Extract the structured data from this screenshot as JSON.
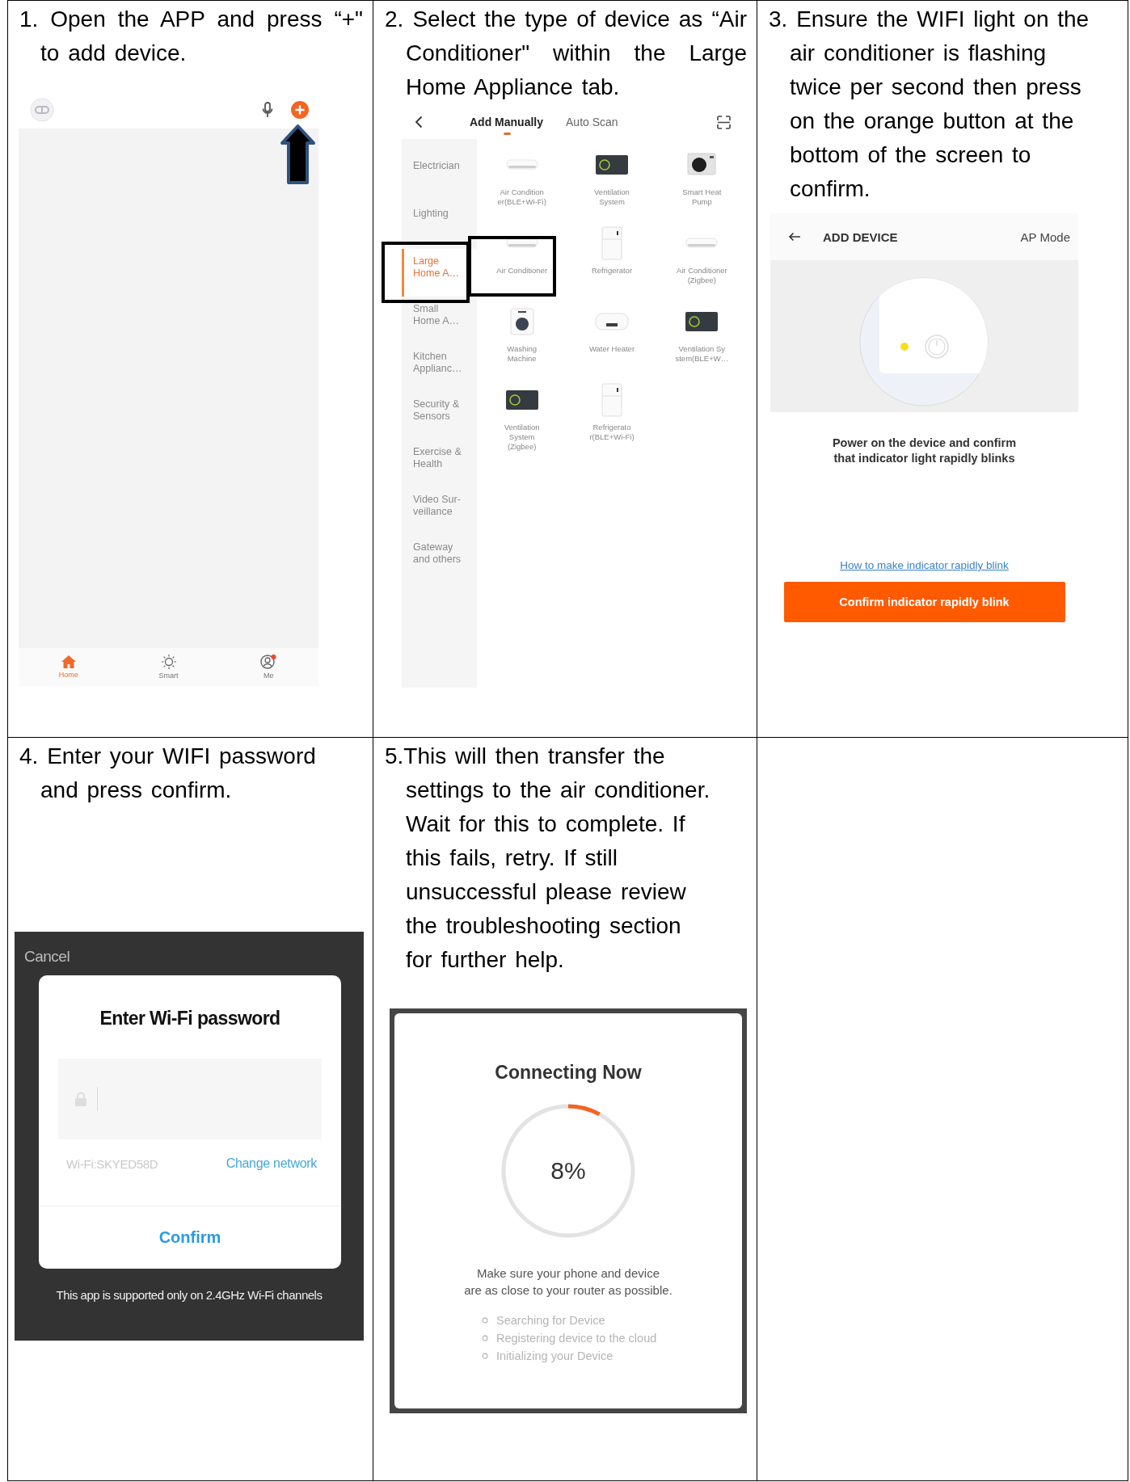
{
  "steps": [
    {
      "text": "1. Open the APP and press “+\" to add device.",
      "screen": {
        "kind": "home",
        "nav": [
          {
            "label": "Home",
            "selected": true
          },
          {
            "label": "Smart",
            "selected": false
          },
          {
            "label": "Me",
            "selected": false
          }
        ]
      }
    },
    {
      "text": "2. Select the type of device as “Air Conditioner\" within the Large Home Appliance tab.",
      "screen": {
        "kind": "catalog",
        "tabs": [
          {
            "label": "Add Manually",
            "selected": true
          },
          {
            "label": "Auto Scan",
            "selected": false
          }
        ],
        "categories": [
          {
            "label": "Electrician",
            "selected": false,
            "highlighted": false
          },
          {
            "label": "Lighting",
            "selected": false,
            "highlighted": false
          },
          {
            "label": "Large\nHome A…",
            "selected": true,
            "highlighted": true
          },
          {
            "label": "Small\nHome A…",
            "selected": false,
            "highlighted": false
          },
          {
            "label": "Kitchen\nApplianc…",
            "selected": false,
            "highlighted": false
          },
          {
            "label": "Security &\nSensors",
            "selected": false,
            "highlighted": false
          },
          {
            "label": "Exercise &\nHealth",
            "selected": false,
            "highlighted": false
          },
          {
            "label": "Video Sur-\nveillance",
            "selected": false,
            "highlighted": false
          },
          {
            "label": "Gateway\nand others",
            "selected": false,
            "highlighted": false
          }
        ],
        "devices": [
          {
            "label": "Air Condition\ner(BLE+Wi-Fi)",
            "kind": "ac",
            "highlighted": false
          },
          {
            "label": "Ventilation\nSystem",
            "kind": "vent",
            "highlighted": false
          },
          {
            "label": "Smart Heat\nPump",
            "kind": "heatpump",
            "highlighted": false
          },
          {
            "label": "Air Conditioner",
            "kind": "ac",
            "highlighted": true
          },
          {
            "label": "Refrigerator",
            "kind": "fridge",
            "highlighted": false
          },
          {
            "label": "Air Conditioner\n(Zigbee)",
            "kind": "ac",
            "highlighted": false
          },
          {
            "label": "Washing\nMachine",
            "kind": "washer",
            "highlighted": false
          },
          {
            "label": "Water Heater",
            "kind": "heater",
            "highlighted": false
          },
          {
            "label": "Ventilation Sy\nstem(BLE+W…",
            "kind": "vent",
            "highlighted": false
          },
          {
            "label": "Ventilation\nSystem\n(Zigbee)",
            "kind": "vent",
            "highlighted": false
          },
          {
            "label": "Refrigerato\nr(BLE+Wi-Fi)",
            "kind": "fridge",
            "highlighted": false
          }
        ]
      }
    },
    {
      "text": "3. Ensure the WIFI light on the\nair conditioner is flashing\ntwice per second then press\non the orange button at the\nbottom of the screen to\nconfirm.",
      "screen": {
        "kind": "ap_mode",
        "title": "ADD DEVICE",
        "mode": "AP Mode",
        "message": "Power on the device and confirm\nthat indicator light rapidly blinks",
        "help_link": "How to make indicator rapidly blink",
        "button": "Confirm indicator rapidly blink"
      }
    },
    {
      "text": "4. Enter your WIFI password\nand press confirm.",
      "screen": {
        "kind": "wifi_password",
        "cancel": "Cancel",
        "title": "Enter Wi-Fi password",
        "network": "Wi-Fi:SKYED58D",
        "change_network": "Change network",
        "confirm": "Confirm",
        "note": "This app is supported only on 2.4GHz Wi-Fi channels"
      }
    },
    {
      "text": "5.This will then transfer the\nsettings to the air conditioner.\nWait for this to complete. If\nthis fails, retry. If still\nunsuccessful please review\nthe troubleshooting section\nfor further help.",
      "screen": {
        "kind": "connecting",
        "title": "Connecting Now",
        "progress": {
          "level": 0.08,
          "reading": "8%"
        },
        "message": "Make sure your phone and device\nare as close to your router as possible.",
        "stages": [
          "Searching for Device",
          "Registering device to the cloud",
          "Initializing your Device"
        ]
      }
    }
  ]
}
